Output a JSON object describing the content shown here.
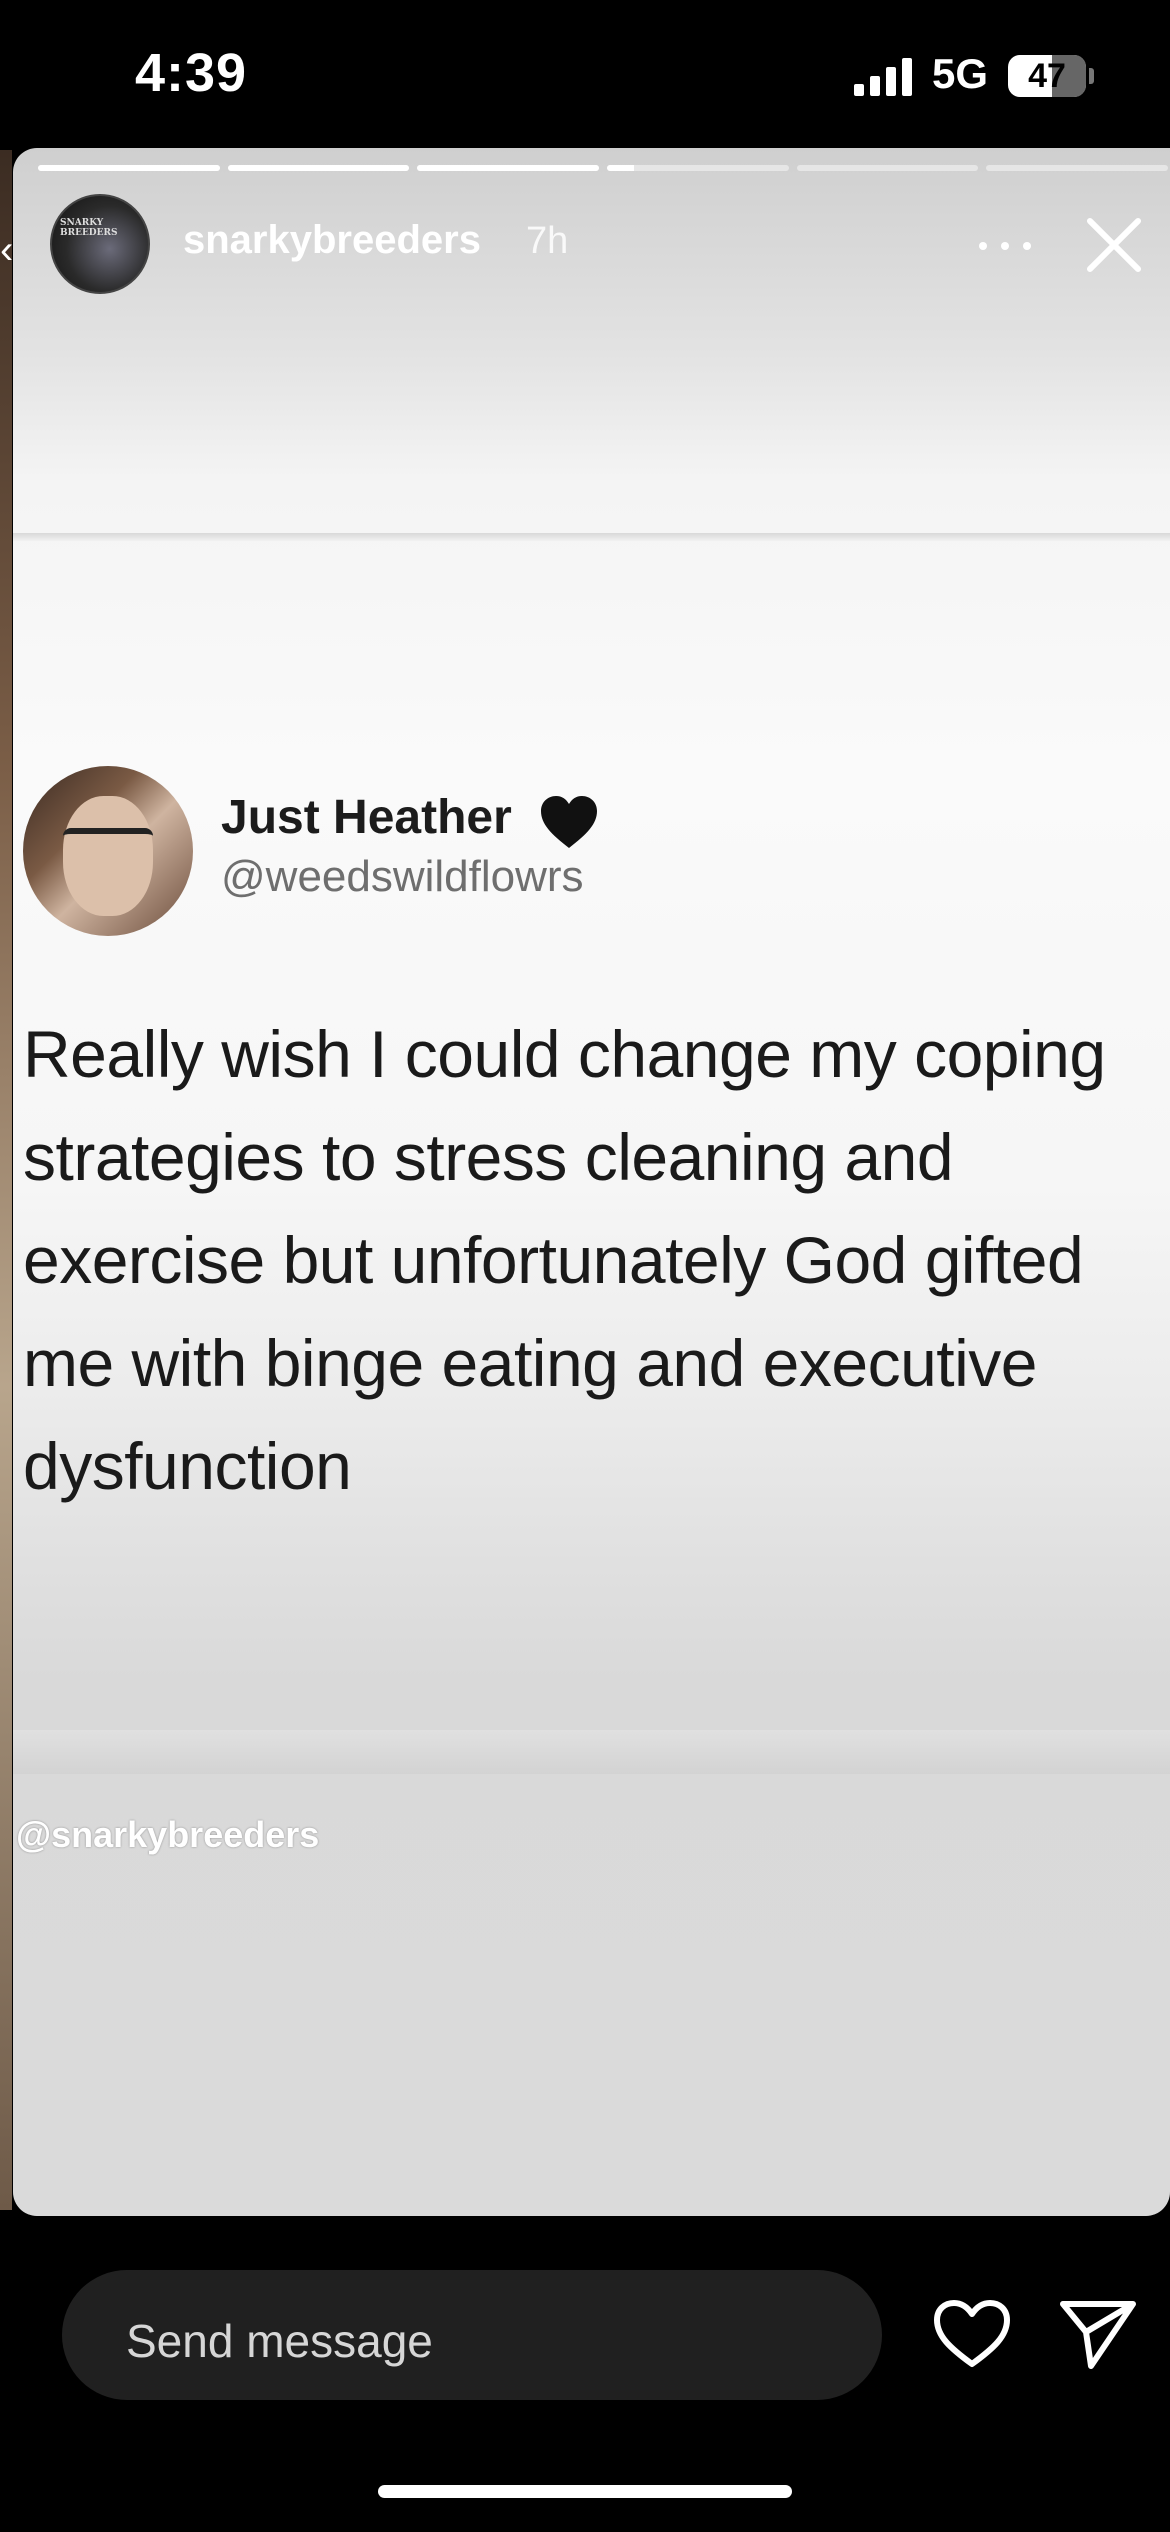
{
  "status_bar": {
    "time": "4:39",
    "network": "5G",
    "battery": "47"
  },
  "story": {
    "username": "snarkybreeders",
    "age": "7h",
    "avatar_label": "SNARKY BREEDERS",
    "progress": [
      1,
      1,
      1,
      0.15,
      0,
      0
    ],
    "tweet": {
      "name": "Just Heather",
      "handle": "@weedswildflowrs",
      "text": "Really wish I could change my coping strategies to stress cleaning and exercise but unfortunately God gifted me with binge eating and executive dysfunction"
    },
    "watermark": "@snarkybreeders"
  },
  "bottom_bar": {
    "message_placeholder": "Send message"
  },
  "icons": [
    "signal-icon",
    "battery-icon",
    "more-icon",
    "close-icon",
    "heart-emoji-icon",
    "like-icon",
    "send-icon"
  ]
}
